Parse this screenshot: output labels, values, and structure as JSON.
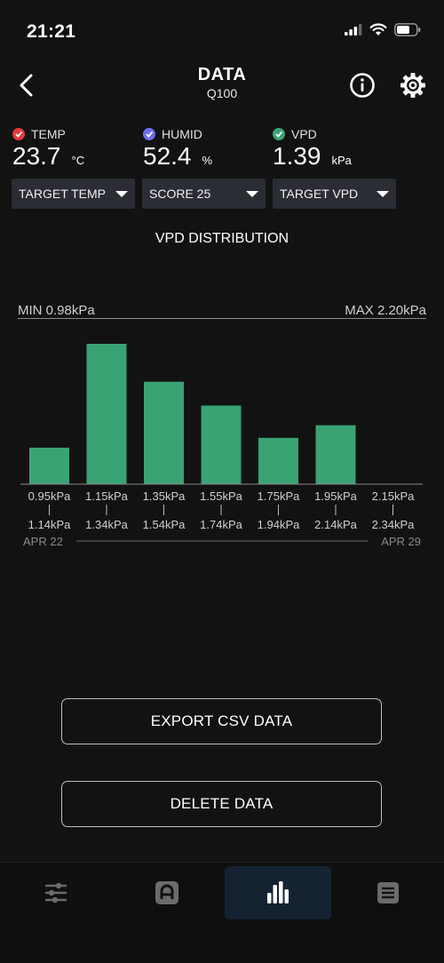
{
  "status_bar": {
    "time": "21:21"
  },
  "header": {
    "title": "DATA",
    "subtitle": "Q100"
  },
  "readings": [
    {
      "label": "TEMP",
      "value": "23.7",
      "unit": "°C",
      "color": "#e5383b"
    },
    {
      "label": "HUMID",
      "value": "52.4",
      "unit": "%",
      "color": "#6c6cf0"
    },
    {
      "label": "VPD",
      "value": "1.39",
      "unit": "kPa",
      "color": "#3aa374"
    }
  ],
  "selects": [
    {
      "value": "TARGET TEMP"
    },
    {
      "value": "SCORE 25"
    },
    {
      "value": "TARGET VPD"
    }
  ],
  "chart_title": "VPD DISTRIBUTION",
  "chart_data": {
    "type": "bar",
    "bar_color": "#3aa374",
    "min_label": "MIN 0.98kPa",
    "max_label": "MAX 2.20kPa",
    "categories": [
      {
        "from": "0.95kPa",
        "to": "1.14kPa"
      },
      {
        "from": "1.15kPa",
        "to": "1.34kPa"
      },
      {
        "from": "1.35kPa",
        "to": "1.54kPa"
      },
      {
        "from": "1.55kPa",
        "to": "1.74kPa"
      },
      {
        "from": "1.75kPa",
        "to": "1.94kPa"
      },
      {
        "from": "1.95kPa",
        "to": "2.14kPa"
      },
      {
        "from": "2.15kPa",
        "to": "2.34kPa"
      }
    ],
    "values": [
      26,
      100,
      73,
      56,
      33,
      42,
      0
    ],
    "date_start": "APR 22",
    "date_end": "APR 29"
  },
  "actions": {
    "export": "EXPORT CSV DATA",
    "delete": "DELETE DATA"
  },
  "tabs": [
    {
      "icon": "sliders-icon"
    },
    {
      "icon": "device-icon"
    },
    {
      "icon": "bar-chart-icon",
      "active": true
    },
    {
      "icon": "list-icon"
    }
  ]
}
